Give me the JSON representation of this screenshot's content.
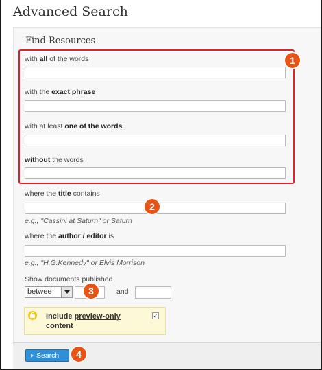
{
  "page": {
    "title": "Advanced Search"
  },
  "section": {
    "title": "Find Resources"
  },
  "fields": {
    "all_words": {
      "prefix": "with ",
      "bold": "all",
      "suffix": " of the words",
      "value": ""
    },
    "exact_phrase": {
      "prefix": "with the ",
      "bold": "exact phrase",
      "suffix": "",
      "value": ""
    },
    "one_of_words": {
      "prefix": "with at least ",
      "bold": "one of the words",
      "suffix": "",
      "value": ""
    },
    "without_words": {
      "prefix": "",
      "bold": "without",
      "suffix": " the words",
      "value": ""
    },
    "title": {
      "prefix": "where the ",
      "bold": "title",
      "suffix": " contains",
      "value": "",
      "hint": "e.g., \"Cassini at Saturn\" or Saturn"
    },
    "author": {
      "prefix": "where the ",
      "bold": "author / editor",
      "suffix": " is",
      "value": "",
      "hint": "e.g., \"H.G.Kennedy\" or Elvis Morrison"
    }
  },
  "published": {
    "label": "Show documents published",
    "select_value": "betwee",
    "and_label": "and",
    "from_value": "",
    "to_value": ""
  },
  "preview": {
    "label_prefix": "Include ",
    "label_underlined": "preview-only",
    "label_suffix": " content",
    "checked_mark": "✓"
  },
  "search_button": {
    "label": "Search"
  },
  "badges": [
    "1",
    "2",
    "3",
    "4"
  ],
  "colors": {
    "highlight": "#e2202a",
    "badge": "#e85316",
    "button": "#2f8fd8"
  }
}
